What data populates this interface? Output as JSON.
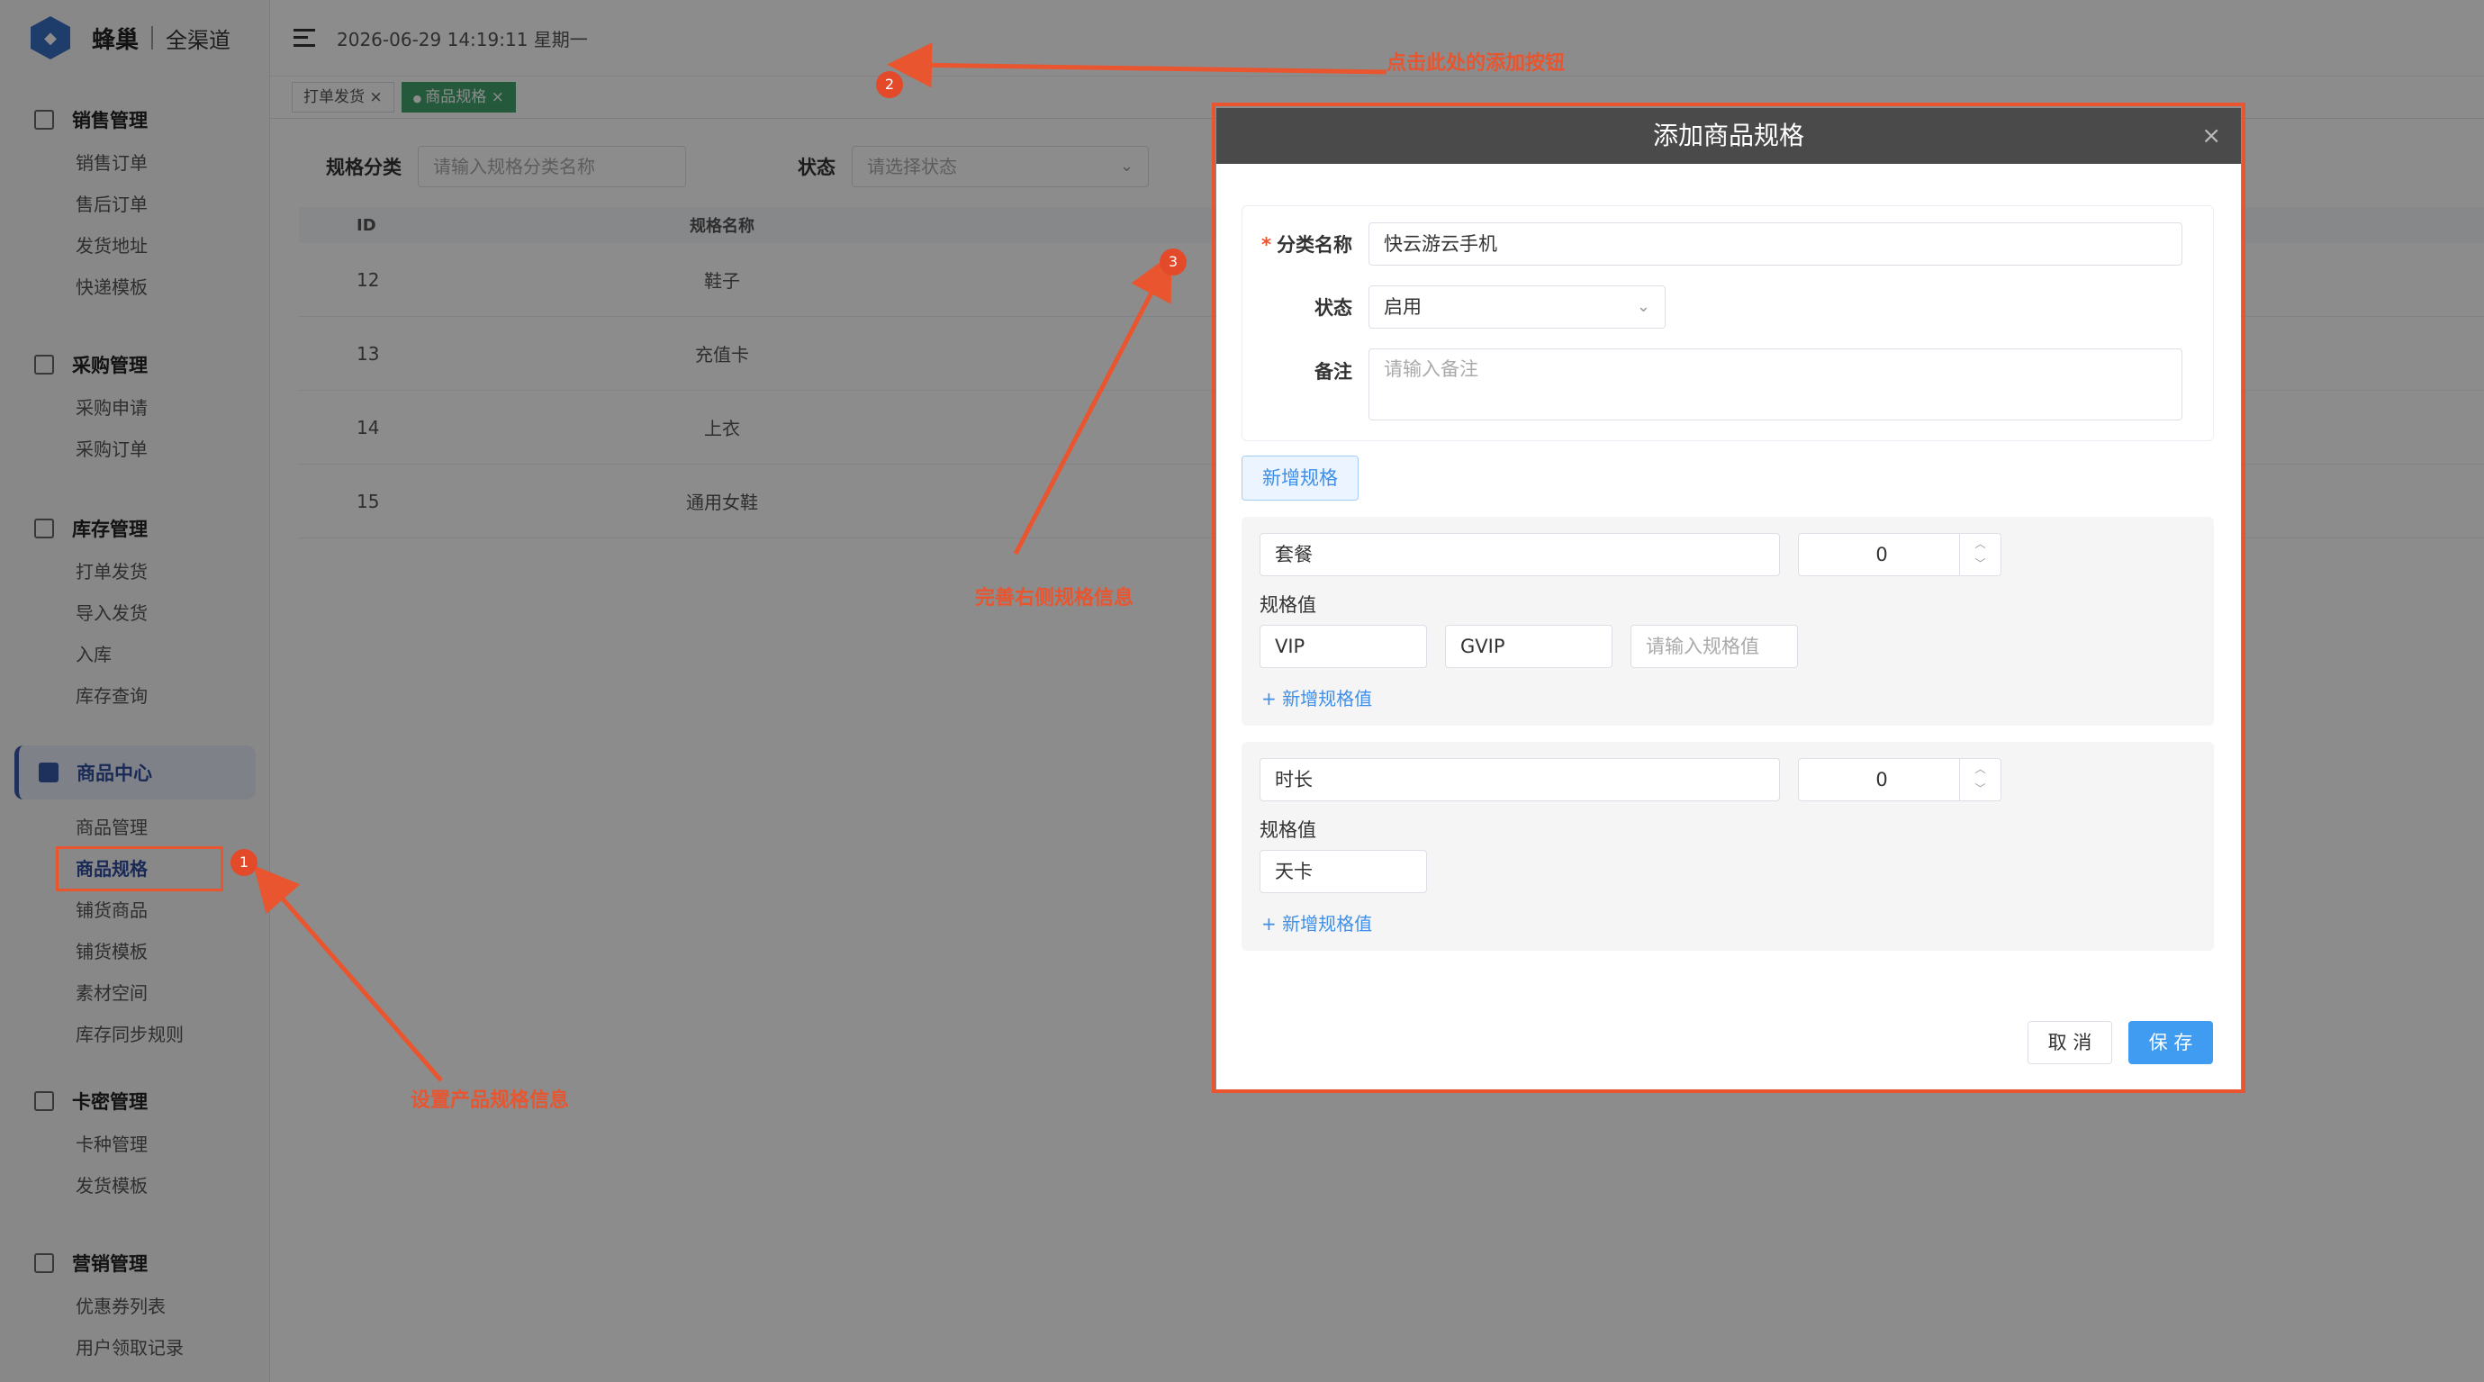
{
  "app": {
    "brand": "蜂巢",
    "subtitle": "全渠道"
  },
  "topbar": {
    "datetime": "2026-06-29 14:19:11 星期一"
  },
  "tabs": [
    {
      "label": "打单发货",
      "close": "×"
    },
    {
      "label": "商品规格",
      "close": "×"
    }
  ],
  "sidebar": {
    "groups": [
      {
        "title": "销售管理",
        "items": [
          "销售订单",
          "售后订单",
          "发货地址",
          "快递模板"
        ]
      },
      {
        "title": "采购管理",
        "items": [
          "采购申请",
          "采购订单"
        ]
      },
      {
        "title": "库存管理",
        "items": [
          "打单发货",
          "导入发货",
          "入库",
          "库存查询"
        ]
      },
      {
        "title": "商品中心",
        "items": [
          "商品管理",
          "商品规格",
          "铺货商品",
          "铺货模板",
          "素材空间",
          "库存同步规则"
        ]
      },
      {
        "title": "卡密管理",
        "items": [
          "卡种管理",
          "发货模板"
        ]
      },
      {
        "title": "营销管理",
        "items": [
          "优惠券列表",
          "用户领取记录"
        ]
      }
    ]
  },
  "filters": {
    "category_label": "规格分类",
    "category_placeholder": "请输入规格分类名称",
    "status_label": "状态",
    "status_placeholder": "请选择状态"
  },
  "table": {
    "headers": [
      "ID",
      "规格名称"
    ],
    "rows": [
      {
        "id": "12",
        "name": "鞋子"
      },
      {
        "id": "13",
        "name": "充值卡"
      },
      {
        "id": "14",
        "name": "上衣"
      },
      {
        "id": "15",
        "name": "通用女鞋"
      }
    ]
  },
  "dialog": {
    "title": "添加商品规格",
    "close": "×",
    "category_label": "分类名称",
    "category_value": "快云游云手机",
    "status_label": "状态",
    "status_value": "启用",
    "remark_label": "备注",
    "remark_placeholder": "请输入备注",
    "add_spec_label": "新增规格",
    "spec_value_label": "规格值",
    "add_value_label": "+ 新增规格值",
    "value_placeholder": "请输入规格值",
    "specs": [
      {
        "name": "套餐",
        "sort": "0",
        "values": [
          "VIP",
          "GVIP"
        ]
      },
      {
        "name": "时长",
        "sort": "0",
        "values": [
          "天卡"
        ]
      }
    ],
    "cancel_label": "取 消",
    "save_label": "保 存"
  },
  "annotations": {
    "step1_text": "设置产品规格信息",
    "step2_text": "点击此处的添加按钮",
    "step3_text": "完善右侧规格信息",
    "badge1": "1",
    "badge2": "2",
    "badge3": "3",
    "color": "#e8552f"
  }
}
